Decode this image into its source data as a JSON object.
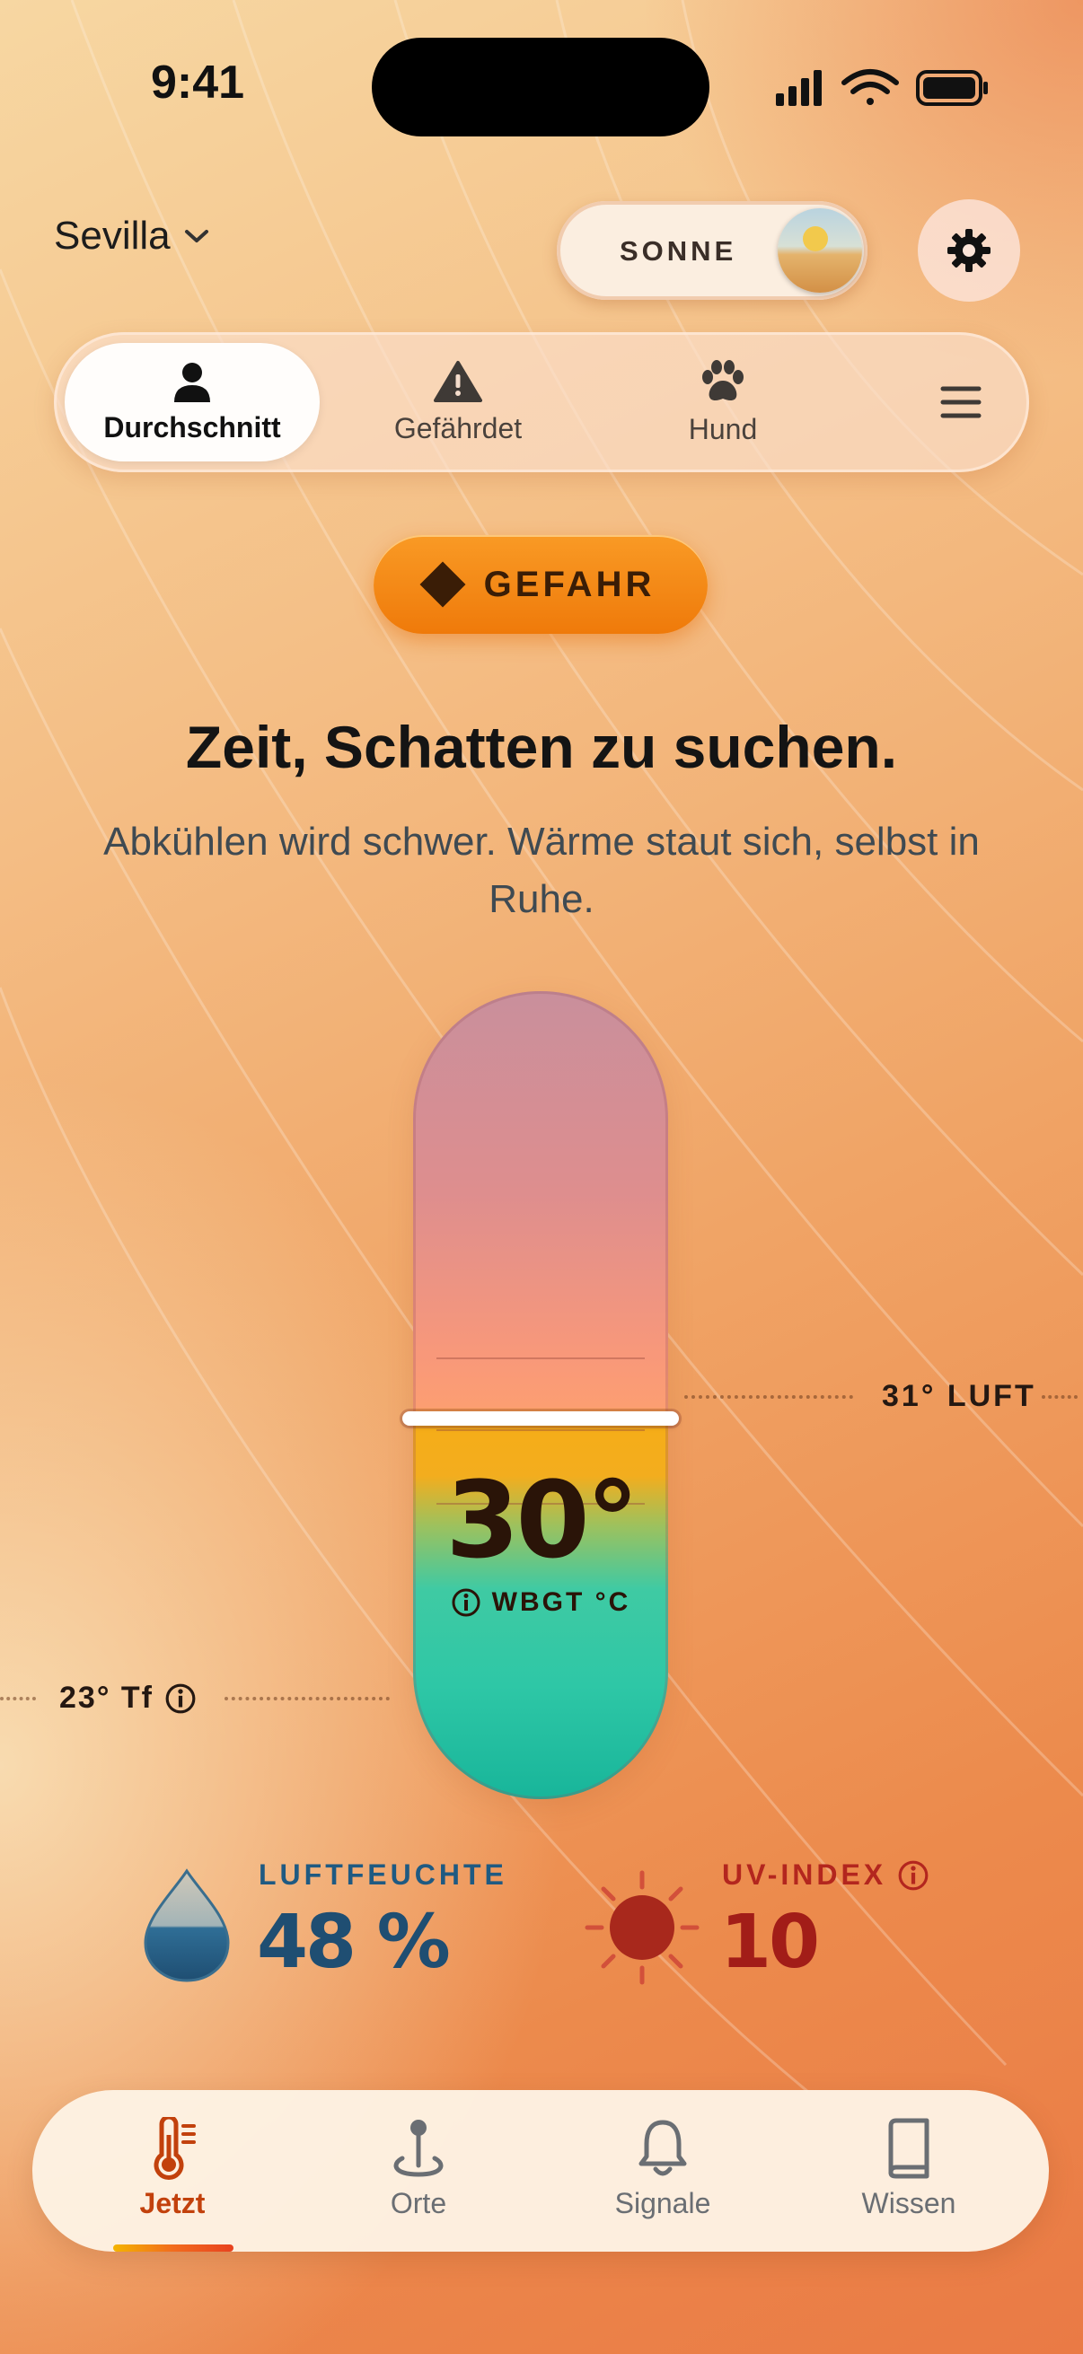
{
  "status_bar": {
    "time": "9:41"
  },
  "header": {
    "location": "Sevilla",
    "mode_toggle_label": "SONNE"
  },
  "audience_tabs": [
    {
      "label": "Durchschnitt",
      "icon": "person-icon",
      "active": true
    },
    {
      "label": "Gefährdet",
      "icon": "warning-icon",
      "active": false
    },
    {
      "label": "Hund",
      "icon": "paw-icon",
      "active": false
    }
  ],
  "risk": {
    "level": "GEFAHR",
    "headline": "Zeit, Schatten zu suchen.",
    "description": "Abkühlen wird schwer. Wärme staut sich, selbst in Ruhe."
  },
  "thermometer": {
    "wbgt_value": "30°",
    "wbgt_unit": "WBGT °C",
    "air_label": "31° LUFT",
    "dewpoint_label": "23° Tf"
  },
  "metrics": {
    "humidity": {
      "label": "LUFTFEUCHTE",
      "value": "48 %"
    },
    "uv": {
      "label": "UV-INDEX",
      "value": "10"
    }
  },
  "bottom_nav": [
    {
      "label": "Jetzt",
      "icon": "thermometer-icon",
      "active": true
    },
    {
      "label": "Orte",
      "icon": "map-pin-icon",
      "active": false
    },
    {
      "label": "Signale",
      "icon": "bell-icon",
      "active": false
    },
    {
      "label": "Wissen",
      "icon": "book-icon",
      "active": false
    }
  ],
  "colors": {
    "risk_orange": "#f08a14",
    "humidity_blue": "#1f4e72",
    "uv_red": "#a21d18",
    "nav_active": "#c2410c"
  }
}
